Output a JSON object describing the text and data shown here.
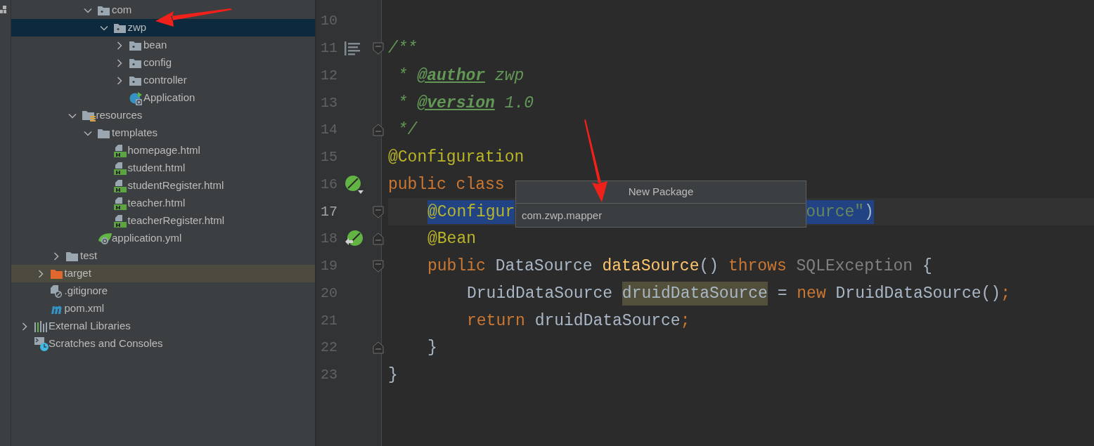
{
  "project_tree": [
    {
      "children": [
        {
          "children": [
            {
              "children": [
                {
                  "children": [
                    {
                      "label": "com",
                      "kind": "package",
                      "expanded": true,
                      "selected": false,
                      "children": [
                        {
                          "label": "zwp",
                          "kind": "package",
                          "expanded": true,
                          "selected": true,
                          "children": [
                            {
                              "label": "bean",
                              "kind": "package",
                              "expanded": false,
                              "selected": false
                            },
                            {
                              "label": "config",
                              "kind": "package",
                              "expanded": false,
                              "selected": false
                            },
                            {
                              "label": "controller",
                              "kind": "package",
                              "expanded": false,
                              "selected": false
                            },
                            {
                              "label": "Application",
                              "kind": "spring-app",
                              "selected": false
                            }
                          ]
                        }
                      ]
                    }
                  ]
                },
                {
                  "label": "resources",
                  "kind": "resources-folder",
                  "expanded": true,
                  "selected": false,
                  "children": [
                    {
                      "label": "templates",
                      "kind": "folder",
                      "expanded": true,
                      "selected": false,
                      "children": [
                        {
                          "label": "homepage.html",
                          "kind": "html-file",
                          "selected": false
                        },
                        {
                          "label": "student.html",
                          "kind": "html-file",
                          "selected": false
                        },
                        {
                          "label": "studentRegister.html",
                          "kind": "html-file",
                          "selected": false
                        },
                        {
                          "label": "teacher.html",
                          "kind": "html-file",
                          "selected": false
                        },
                        {
                          "label": "teacherRegister.html",
                          "kind": "html-file",
                          "selected": false
                        }
                      ]
                    },
                    {
                      "label": "application.yml",
                      "kind": "spring-config",
                      "selected": false
                    }
                  ]
                }
              ]
            },
            {
              "label": "test",
              "kind": "folder",
              "expanded": false,
              "selected": false
            }
          ]
        },
        {
          "label": "target",
          "kind": "excluded-folder",
          "expanded": false,
          "selected": false
        },
        {
          "label": ".gitignore",
          "kind": "ignore-file",
          "selected": false
        },
        {
          "label": "pom.xml",
          "kind": "maven-file",
          "selected": false
        }
      ]
    },
    {
      "label": "External Libraries",
      "kind": "libraries",
      "expanded": false,
      "selected": false
    },
    {
      "label": "Scratches and Consoles",
      "kind": "scratches",
      "selected": false
    }
  ],
  "editor": {
    "lines": [
      {
        "number": "10",
        "kind": "class",
        "current": false
      },
      {
        "number": "11",
        "kind": "class",
        "current": false,
        "selected": false,
        "gutter": {
          "kind": "reader-mode"
        },
        "fold": {
          "kind": "start"
        },
        "tokens": [
          {
            "text": "/**",
            "kind": "comment"
          }
        ]
      },
      {
        "number": "12",
        "kind": "class",
        "current": false,
        "selected": false,
        "tokens": [
          {
            "text": " * ",
            "kind": "comment"
          },
          {
            "text": "@author",
            "kind": "doc-tag"
          },
          {
            "text": " zwp",
            "kind": "comment"
          }
        ]
      },
      {
        "number": "13",
        "kind": "class",
        "current": false,
        "selected": false,
        "tokens": [
          {
            "text": " * ",
            "kind": "comment"
          },
          {
            "text": "@version",
            "kind": "doc-tag"
          },
          {
            "text": " 1.0",
            "kind": "comment"
          }
        ]
      },
      {
        "number": "14",
        "kind": "class",
        "current": false,
        "selected": false,
        "fold": {
          "kind": "end"
        },
        "tokens": [
          {
            "text": " */",
            "kind": "comment"
          }
        ]
      },
      {
        "number": "15",
        "kind": "class",
        "current": false,
        "selected": false,
        "tokens": [
          {
            "text": "@Configuration",
            "kind": "annotation"
          }
        ]
      },
      {
        "number": "16",
        "kind": "class",
        "current": false,
        "selected": false,
        "gutter": {
          "kind": "bean"
        },
        "tokens": [
          {
            "text": "public class ",
            "kind": "keyword"
          }
        ]
      },
      {
        "number": "17",
        "kind": "member",
        "current": true,
        "selected": true,
        "fold": {
          "kind": "start"
        },
        "tokens": [
          {
            "text": "@Configur",
            "kind": "annotation"
          },
          {
            "kind": "covered"
          },
          {
            "text": "ource\"",
            "kind": "string"
          },
          {
            "text": ")",
            "kind": "plain"
          }
        ]
      },
      {
        "number": "18",
        "kind": "member",
        "current": false,
        "selected": false,
        "gutter": {
          "kind": "bean-method"
        },
        "fold": {
          "kind": "end"
        },
        "tokens": [
          {
            "text": "@Bean",
            "kind": "annotation"
          }
        ]
      },
      {
        "number": "19",
        "kind": "member",
        "current": false,
        "selected": false,
        "fold": {
          "kind": "start"
        },
        "tokens": [
          {
            "text": "public ",
            "kind": "keyword"
          },
          {
            "text": "DataSource ",
            "kind": "plain"
          },
          {
            "text": "dataSource",
            "kind": "method"
          },
          {
            "text": "() ",
            "kind": "plain"
          },
          {
            "text": "throws ",
            "kind": "keyword"
          },
          {
            "text": "SQLException",
            "kind": "unused"
          },
          {
            "text": " {",
            "kind": "plain"
          }
        ]
      },
      {
        "number": "20",
        "kind": "body",
        "current": false,
        "selected": false,
        "tokens": [
          {
            "text": "DruidDataSource ",
            "kind": "plain"
          },
          {
            "text": "druidDataSource",
            "kind": "usage"
          },
          {
            "text": " = ",
            "kind": "plain"
          },
          {
            "text": "new ",
            "kind": "keyword"
          },
          {
            "text": "DruidDataSource()",
            "kind": "plain"
          },
          {
            "text": ";",
            "kind": "keyword"
          }
        ]
      },
      {
        "number": "21",
        "kind": "body",
        "current": false,
        "selected": false,
        "tokens": [
          {
            "text": "return ",
            "kind": "keyword"
          },
          {
            "text": "druidDataSource",
            "kind": "plain"
          },
          {
            "text": ";",
            "kind": "keyword"
          }
        ]
      },
      {
        "number": "22",
        "kind": "member",
        "current": false,
        "selected": false,
        "fold": {
          "kind": "end"
        },
        "tokens": [
          {
            "text": "}",
            "kind": "plain"
          }
        ]
      },
      {
        "number": "23",
        "kind": "class",
        "current": false,
        "selected": false,
        "tokens": [
          {
            "text": "}",
            "kind": "plain"
          }
        ]
      }
    ]
  },
  "new_package_popup": {
    "title": "New Package",
    "value": "com.zwp.mapper"
  }
}
